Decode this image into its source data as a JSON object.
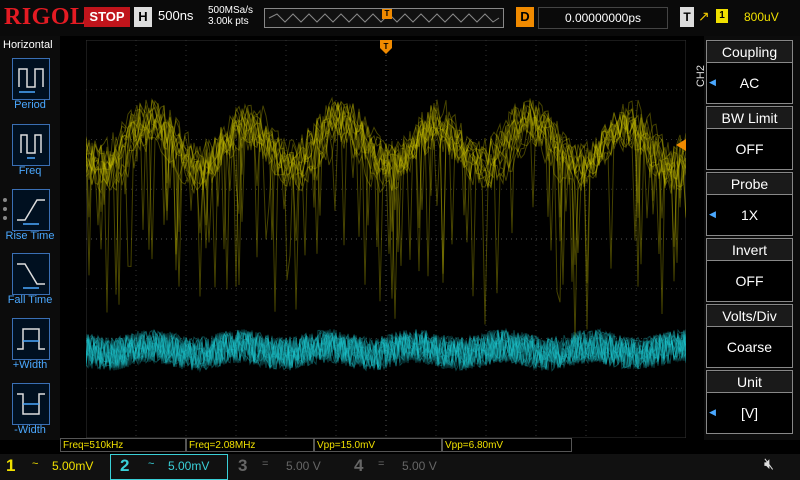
{
  "brand": "RIGOL",
  "run_state": "STOP",
  "horizontal": {
    "label": "H",
    "timebase": "500ns",
    "sample_rate": "500MSa/s",
    "points": "3.00k pts"
  },
  "trigger_marker": "T",
  "delay": {
    "label": "D",
    "value": "0.00000000ps"
  },
  "trigger": {
    "label": "T",
    "source": "1",
    "level": "800uV"
  },
  "left_menu": {
    "title": "Horizontal",
    "items": [
      {
        "label": "Period"
      },
      {
        "label": "Freq"
      },
      {
        "label": "Rise Time"
      },
      {
        "label": "Fall Time"
      },
      {
        "label": "+Width"
      },
      {
        "label": "-Width"
      }
    ]
  },
  "right_menu": {
    "channel": "CH2",
    "items": [
      {
        "title": "Coupling",
        "value": "AC"
      },
      {
        "title": "BW Limit",
        "value": "OFF"
      },
      {
        "title": "Probe",
        "value": "1X"
      },
      {
        "title": "Invert",
        "value": "OFF"
      },
      {
        "title": "Volts/Div",
        "value": "Coarse"
      },
      {
        "title": "Unit",
        "value": "[V]"
      }
    ]
  },
  "channel_markers": {
    "ch1": "1",
    "ch2": "2"
  },
  "measurements": [
    {
      "text": "Freq=510kHz"
    },
    {
      "text": "Freq=2.08MHz"
    },
    {
      "text": "Vpp=15.0mV"
    },
    {
      "text": "Vpp=6.80mV"
    }
  ],
  "channels": [
    {
      "num": "1",
      "coupling": "~",
      "scale": "5.00mV",
      "color": "#f0e000"
    },
    {
      "num": "2",
      "coupling": "~",
      "scale": "5.00mV",
      "color": "#3ad0d8"
    },
    {
      "num": "3",
      "coupling": "=",
      "scale": "5.00 V",
      "color": "#666666"
    },
    {
      "num": "4",
      "coupling": "=",
      "scale": "5.00 V",
      "color": "#666666"
    }
  ],
  "colors": {
    "ch1": "#c8c000",
    "ch2": "#1ec8d0",
    "trigger": "#f08a00",
    "brand": "#e31b23"
  },
  "icons": {
    "speaker": "speaker-mute-icon"
  }
}
